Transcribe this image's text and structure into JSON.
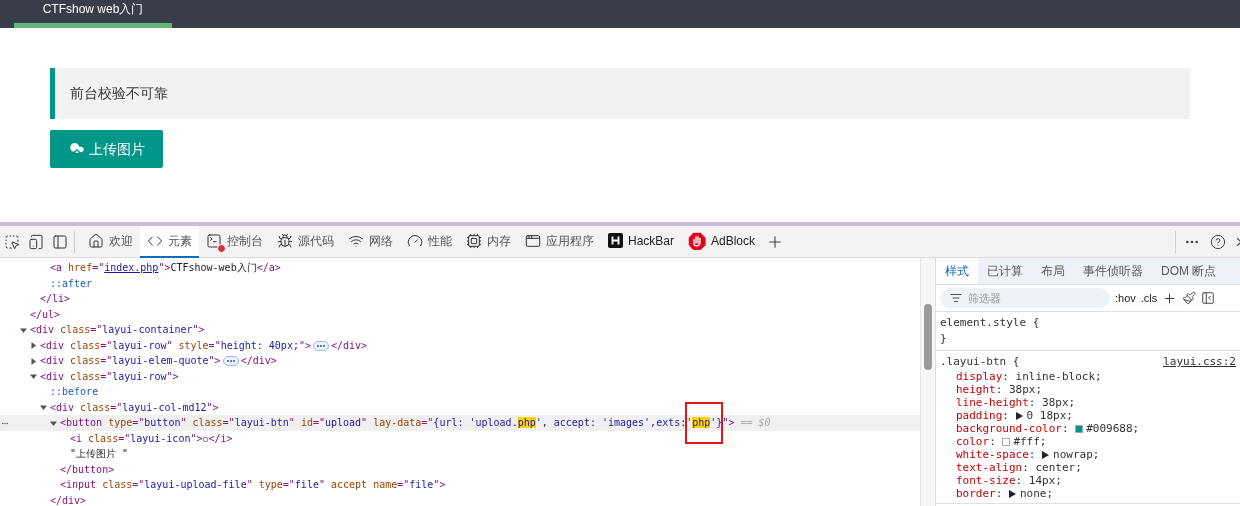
{
  "page": {
    "nav_items": [
      {
        "label": "CTFshow web入门",
        "selected": true
      }
    ],
    "quote": "前台校验不可靠",
    "upload_button": "上传图片"
  },
  "devtools": {
    "tabs": [
      {
        "kind": "home",
        "label": "欢迎",
        "selected": false,
        "alert": false
      },
      {
        "kind": "code",
        "label": "元素",
        "selected": true,
        "alert": false
      },
      {
        "kind": "console",
        "label": "控制台",
        "selected": false,
        "alert": true
      },
      {
        "kind": "bug",
        "label": "源代码",
        "selected": false,
        "alert": false
      },
      {
        "kind": "wifi",
        "label": "网络",
        "selected": false,
        "alert": false
      },
      {
        "kind": "gauge",
        "label": "性能",
        "selected": false,
        "alert": false
      },
      {
        "kind": "chip",
        "label": "内存",
        "selected": false,
        "alert": false
      },
      {
        "kind": "window",
        "label": "应用程序",
        "selected": false,
        "alert": false
      },
      {
        "kind": "hackbar",
        "label": "HackBar",
        "selected": false,
        "alert": false
      },
      {
        "kind": "adblock",
        "label": "AdBlock",
        "selected": false,
        "alert": false
      }
    ],
    "dom_tree": [
      {
        "children": [
          {
            "children": [
              {
                "selected": false,
                "tokens": [
                  {
                    "kind": "tag",
                    "text": "<a"
                  },
                  {
                    "kind": "attr",
                    "text": " href"
                  },
                  {
                    "kind": "tag",
                    "text": "=\""
                  },
                  {
                    "kind": "link",
                    "text": "index.php"
                  },
                  {
                    "kind": "tag",
                    "text": "\">"
                  },
                  {
                    "kind": "text",
                    "text": "CTFshow-web入门"
                  },
                  {
                    "kind": "tag",
                    "text": "</a>"
                  }
                ]
              },
              {
                "selected": false,
                "tokens": [
                  {
                    "kind": "pseudo",
                    "text": "::after"
                  }
                ]
              }
            ],
            "close": [
              {
                "kind": "tag",
                "text": "</li>"
              }
            ]
          }
        ],
        "close": [
          {
            "kind": "tag",
            "text": "</ul>"
          }
        ]
      },
      {
        "selected": false,
        "expanded": true,
        "tokens": [
          {
            "kind": "tag",
            "text": "<div"
          },
          {
            "kind": "attr",
            "text": " class"
          },
          {
            "kind": "tag",
            "text": "=\""
          },
          {
            "kind": "value",
            "text": "layui-container"
          },
          {
            "kind": "tag",
            "text": "\">"
          }
        ],
        "children": [
          {
            "selected": false,
            "expanded": false,
            "tokens": [
              {
                "kind": "tag",
                "text": "<div"
              },
              {
                "kind": "attr",
                "text": " class"
              },
              {
                "kind": "tag",
                "text": "=\""
              },
              {
                "kind": "value",
                "text": "layui-row"
              },
              {
                "kind": "tag",
                "text": "\""
              },
              {
                "kind": "attr",
                "text": " style"
              },
              {
                "kind": "tag",
                "text": "=\""
              },
              {
                "kind": "value",
                "text": "height: 40px;"
              },
              {
                "kind": "tag",
                "text": "\">"
              }
            ],
            "close": [
              {
                "kind": "tag",
                "text": "</div>"
              }
            ]
          },
          {
            "selected": false,
            "expanded": false,
            "tokens": [
              {
                "kind": "tag",
                "text": "<div"
              },
              {
                "kind": "attr",
                "text": " class"
              },
              {
                "kind": "tag",
                "text": "=\""
              },
              {
                "kind": "value",
                "text": "layui-elem-quote"
              },
              {
                "kind": "tag",
                "text": "\">"
              }
            ],
            "close": [
              {
                "kind": "tag",
                "text": "</div>"
              }
            ]
          },
          {
            "selected": false,
            "expanded": true,
            "tokens": [
              {
                "kind": "tag",
                "text": "<div"
              },
              {
                "kind": "attr",
                "text": " class"
              },
              {
                "kind": "tag",
                "text": "=\""
              },
              {
                "kind": "value",
                "text": "layui-row"
              },
              {
                "kind": "tag",
                "text": "\">"
              }
            ],
            "children": [
              {
                "selected": false,
                "tokens": [
                  {
                    "kind": "pseudo",
                    "text": "::before"
                  }
                ]
              },
              {
                "selected": false,
                "expanded": true,
                "tokens": [
                  {
                    "kind": "tag",
                    "text": "<div"
                  },
                  {
                    "kind": "attr",
                    "text": " class"
                  },
                  {
                    "kind": "tag",
                    "text": "=\""
                  },
                  {
                    "kind": "value",
                    "text": "layui-col-md12"
                  },
                  {
                    "kind": "tag",
                    "text": "\">"
                  }
                ],
                "children": [
                  {
                    "selected": true,
                    "expanded": true,
                    "tokens": [
                      {
                        "kind": "tag",
                        "text": "<button"
                      },
                      {
                        "kind": "attr",
                        "text": " type"
                      },
                      {
                        "kind": "tag",
                        "text": "=\""
                      },
                      {
                        "kind": "value",
                        "text": "button"
                      },
                      {
                        "kind": "tag",
                        "text": "\""
                      },
                      {
                        "kind": "attr",
                        "text": " class"
                      },
                      {
                        "kind": "tag",
                        "text": "=\""
                      },
                      {
                        "kind": "value",
                        "text": "layui-btn"
                      },
                      {
                        "kind": "tag",
                        "text": "\""
                      },
                      {
                        "kind": "attr",
                        "text": " id"
                      },
                      {
                        "kind": "tag",
                        "text": "=\""
                      },
                      {
                        "kind": "value",
                        "text": "upload"
                      },
                      {
                        "kind": "tag",
                        "text": "\""
                      },
                      {
                        "kind": "attr",
                        "text": " lay-data"
                      },
                      {
                        "kind": "tag",
                        "text": "=\""
                      },
                      {
                        "kind": "value",
                        "text": "{url: 'upload."
                      },
                      {
                        "kind": "match",
                        "text": "php"
                      },
                      {
                        "kind": "value",
                        "text": "', accept: 'images',exts:'"
                      },
                      {
                        "kind": "match",
                        "text": "php",
                        "boxed": true
                      },
                      {
                        "kind": "value",
                        "text": "'}"
                      },
                      {
                        "kind": "tag",
                        "text": "\">"
                      },
                      {
                        "kind": "ref",
                        "text": " == $0"
                      }
                    ],
                    "children": [
                      {
                        "selected": false,
                        "tokens": [
                          {
                            "kind": "tag",
                            "text": "<i"
                          },
                          {
                            "kind": "attr",
                            "text": " class"
                          },
                          {
                            "kind": "tag",
                            "text": "=\""
                          },
                          {
                            "kind": "value",
                            "text": "layui-icon"
                          },
                          {
                            "kind": "tag",
                            "text": "\">"
                          },
                          {
                            "kind": "text",
                            "text": "▫"
                          },
                          {
                            "kind": "tag",
                            "text": "</i>"
                          }
                        ]
                      },
                      {
                        "selected": false,
                        "tokens": [
                          {
                            "kind": "text",
                            "text": "\"上传图片 \""
                          }
                        ]
                      }
                    ],
                    "close": [
                      {
                        "kind": "tag",
                        "text": "</button>"
                      }
                    ]
                  },
                  {
                    "selected": false,
                    "tokens": [
                      {
                        "kind": "tag",
                        "text": "<input"
                      },
                      {
                        "kind": "attr",
                        "text": " class"
                      },
                      {
                        "kind": "tag",
                        "text": "=\""
                      },
                      {
                        "kind": "value",
                        "text": "layui-upload-file"
                      },
                      {
                        "kind": "tag",
                        "text": "\""
                      },
                      {
                        "kind": "attr",
                        "text": " type"
                      },
                      {
                        "kind": "tag",
                        "text": "=\""
                      },
                      {
                        "kind": "value",
                        "text": "file"
                      },
                      {
                        "kind": "tag",
                        "text": "\""
                      },
                      {
                        "kind": "attr",
                        "text": " accept name"
                      },
                      {
                        "kind": "tag",
                        "text": "=\""
                      },
                      {
                        "kind": "value",
                        "text": "file"
                      },
                      {
                        "kind": "tag",
                        "text": "\">"
                      }
                    ]
                  }
                ],
                "close": [
                  {
                    "kind": "tag",
                    "text": "</div>"
                  }
                ]
              }
            ]
          }
        ]
      }
    ],
    "styles_tabs": [
      {
        "label": "样式",
        "selected": true
      },
      {
        "label": "已计算",
        "selected": false
      },
      {
        "label": "布局",
        "selected": false
      },
      {
        "label": "事件侦听器",
        "selected": false
      },
      {
        "label": "DOM 断点",
        "selected": false
      }
    ],
    "filter": {
      "placeholder": "筛选器"
    },
    "filter_tools": [
      ":hov",
      ".cls"
    ],
    "rules": [
      {
        "selector": "element.style",
        "open": "{",
        "close": "}"
      },
      {
        "selector": ".layui-btn",
        "open": "{",
        "source": "layui.css:2",
        "separator": ":",
        "properties": [
          {
            "name": "display",
            "value": "inline-block;",
            "expandable": false
          },
          {
            "name": "height",
            "value": "38px;",
            "expandable": false
          },
          {
            "name": "line-height",
            "value": "38px;",
            "expandable": false
          },
          {
            "name": "padding",
            "value": "0 18px;",
            "expandable": true
          },
          {
            "name": "background-color",
            "value": "#009688;",
            "expandable": false,
            "color": "#009688"
          },
          {
            "name": "color",
            "value": "#fff;",
            "expandable": false,
            "color": "#ffffff"
          },
          {
            "name": "white-space",
            "value": "nowrap;",
            "expandable": true
          },
          {
            "name": "text-align",
            "value": "center;",
            "expandable": false
          },
          {
            "name": "font-size",
            "value": "14px;",
            "expandable": false
          },
          {
            "name": "border",
            "value": "none;",
            "expandable": true
          }
        ]
      }
    ]
  }
}
